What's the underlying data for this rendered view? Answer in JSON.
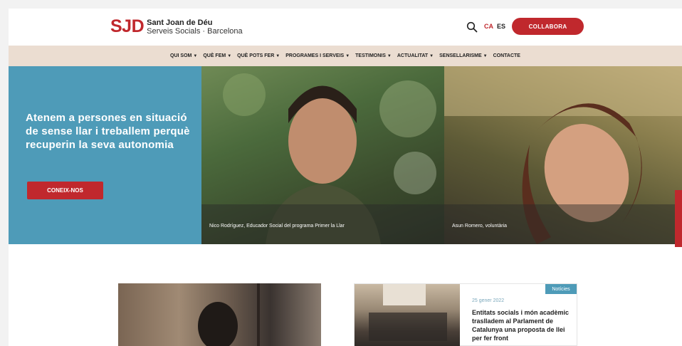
{
  "header": {
    "logo_mark": "SJD",
    "logo_line1": "Sant Joan de Déu",
    "logo_line2": "Serveis Socials · Barcelona",
    "lang_ca": "CA",
    "lang_es": "ES",
    "collabora": "COLLABORA"
  },
  "nav": {
    "items": [
      {
        "label": "QUI SOM",
        "dropdown": true
      },
      {
        "label": "QUÈ FEM",
        "dropdown": true
      },
      {
        "label": "QUÈ POTS FER",
        "dropdown": true
      },
      {
        "label": "PROGRAMES I SERVEIS",
        "dropdown": true
      },
      {
        "label": "TESTIMONIS",
        "dropdown": true
      },
      {
        "label": "ACTUALITAT",
        "dropdown": true
      },
      {
        "label": "SENSELLARISME",
        "dropdown": true
      },
      {
        "label": "CONTACTE",
        "dropdown": false
      }
    ]
  },
  "hero": {
    "title": "Atenem a persones en situació de sense llar i treballem perquè recuperin la seva autonomia",
    "button": "CONEIX-NOS",
    "photos": [
      {
        "caption": "Nico Rodríguez, Educador Social del programa Primer la Llar"
      },
      {
        "caption": "Asun Romero, voluntària"
      }
    ]
  },
  "news": {
    "badge": "Notícies",
    "date": "25 gener 2022",
    "title": "Entitats socials i món acadèmic traslladem al Parlament de Catalunya una proposta de llei per fer front"
  },
  "colors": {
    "brand_red": "#c0282d",
    "hero_blue": "#4e9bb8",
    "nav_beige": "#ebddd1"
  }
}
